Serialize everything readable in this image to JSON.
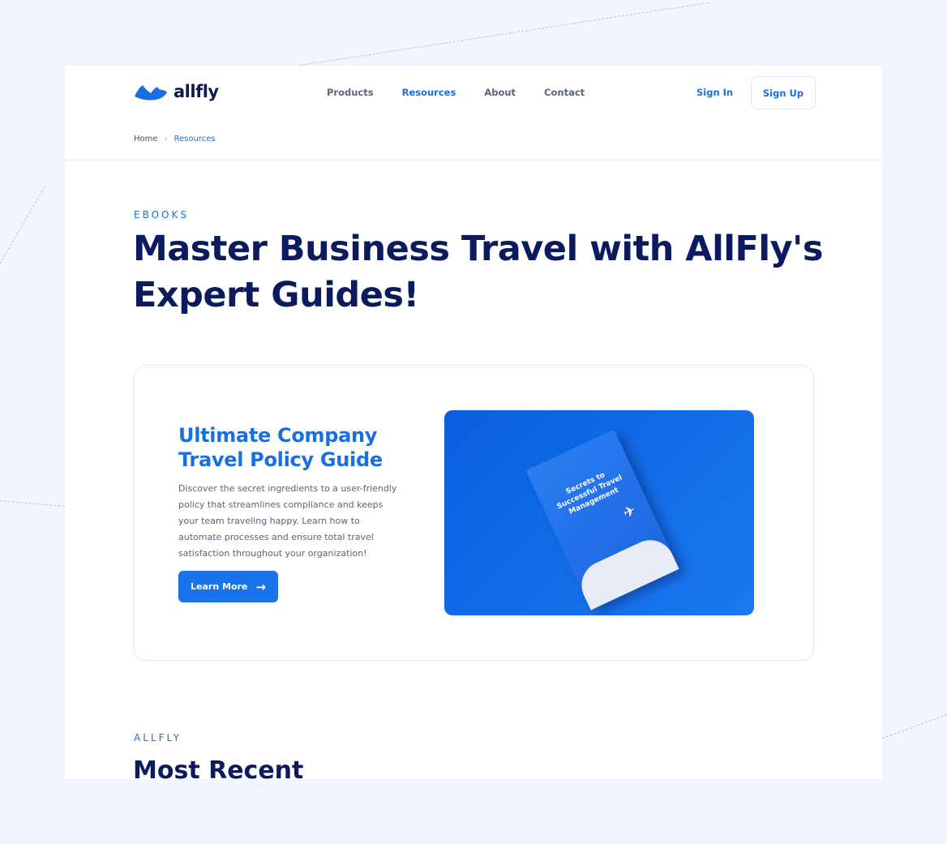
{
  "brand": {
    "name": "allfly"
  },
  "nav": {
    "items": [
      {
        "label": "Products"
      },
      {
        "label": "Resources",
        "active": true
      },
      {
        "label": "About"
      },
      {
        "label": "Contact"
      }
    ],
    "sign_in": "Sign In",
    "sign_up": "Sign Up"
  },
  "breadcrumb": {
    "home": "Home",
    "current": "Resources"
  },
  "hero": {
    "eyebrow": "EBOOKS",
    "title": "Master Business Travel with AllFly's Expert Guides!"
  },
  "feature": {
    "title": "Ultimate Company Travel Policy Guide",
    "description": "Discover the secret ingredients to a user-friendly policy that streamlines compliance and keeps your team traveling happy. Learn how to automate processes and ensure total travel satisfaction throughout your organization!",
    "button": "Learn More",
    "book_title": "Secrets to Successful Travel Management"
  },
  "recent": {
    "eyebrow": "ALLFLY",
    "title": "Most Recent"
  },
  "colors": {
    "accent": "#1a6fe0",
    "heading": "#0b1b5e",
    "background": "#f1f6fe"
  }
}
